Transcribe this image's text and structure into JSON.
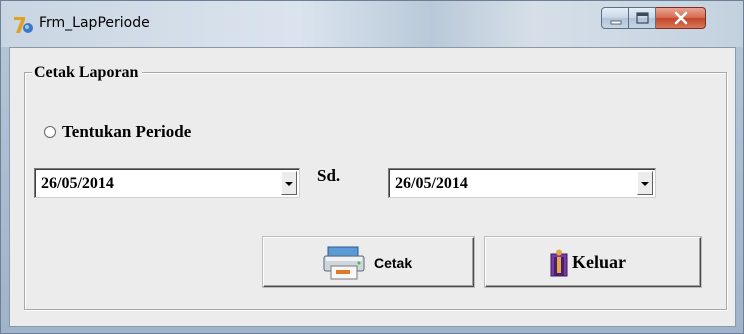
{
  "window": {
    "title": "Frm_LapPeriode",
    "controls": {
      "minimize": "minimize-icon",
      "maximize": "maximize-icon",
      "close": "close-icon"
    }
  },
  "group": {
    "title": "Cetak Laporan"
  },
  "period": {
    "option_label": "Tentukan Periode",
    "selected": false,
    "from_date": "26/05/2014",
    "separator_label": "Sd.",
    "to_date": "26/05/2014"
  },
  "buttons": {
    "print_label": "Cetak",
    "exit_label": "Keluar"
  },
  "colors": {
    "titlebar": "#c9d5e2",
    "close_button": "#c2452a",
    "client_bg": "#ececec"
  }
}
